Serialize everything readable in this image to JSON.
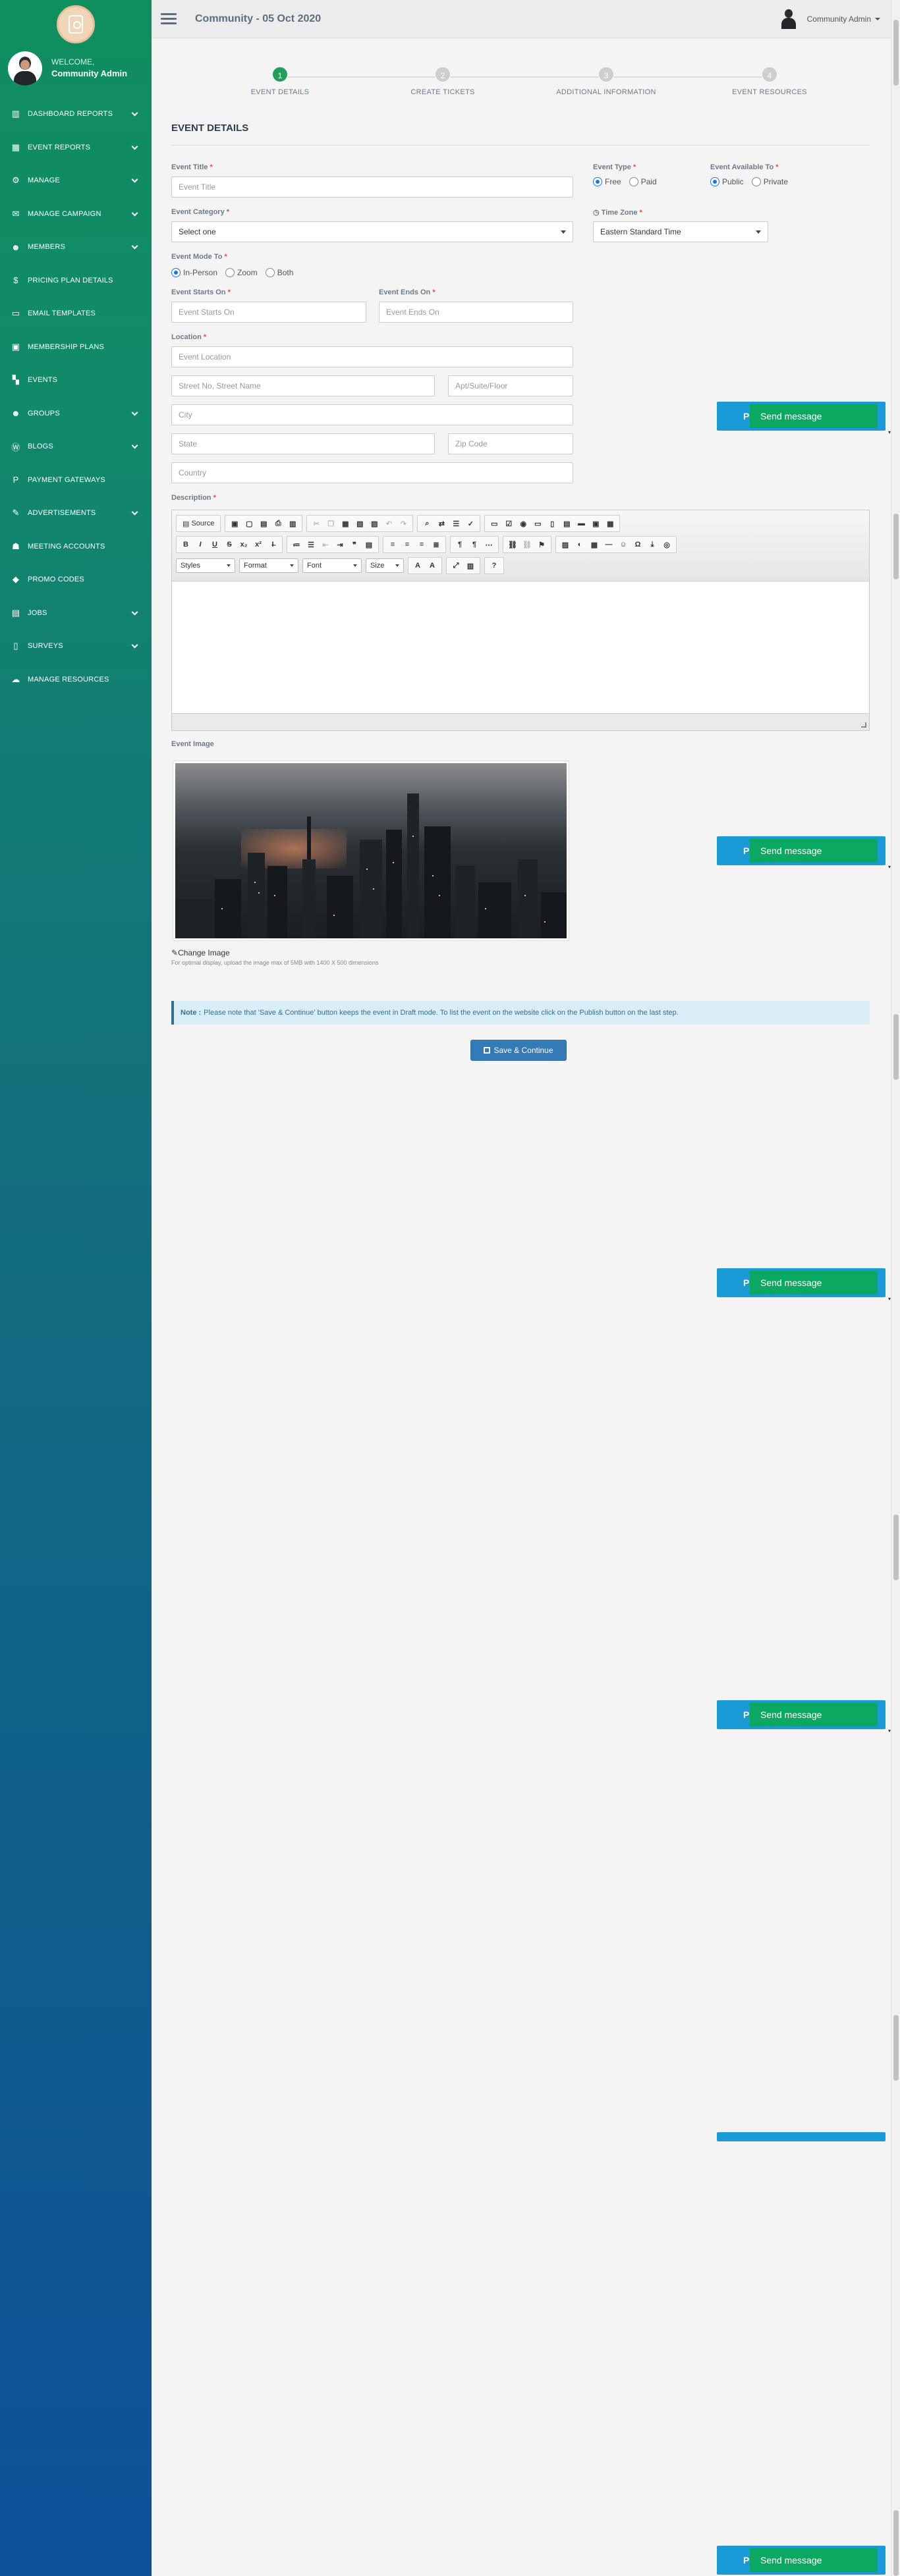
{
  "sidebar": {
    "welcome": "WELCOME,",
    "username": "Community Admin",
    "items": [
      {
        "label": "DASHBOARD REPORTS",
        "icon": "bar-chart-icon",
        "glyph": "▥",
        "chevron": true
      },
      {
        "label": "EVENT REPORTS",
        "icon": "grid-icon",
        "glyph": "▦",
        "chevron": true
      },
      {
        "label": "MANAGE",
        "icon": "gears-icon",
        "glyph": "⚙",
        "chevron": true
      },
      {
        "label": "MANAGE CAMPAIGN",
        "icon": "envelope-icon",
        "glyph": "✉",
        "chevron": true
      },
      {
        "label": "MEMBERS",
        "icon": "users-icon",
        "glyph": "☻",
        "chevron": true
      },
      {
        "label": "PRICING PLAN DETAILS",
        "icon": "dollar-icon",
        "glyph": "$",
        "chevron": false
      },
      {
        "label": "EMAIL TEMPLATES",
        "icon": "email-template-icon",
        "glyph": "▭",
        "chevron": false
      },
      {
        "label": "MEMBERSHIP PLANS",
        "icon": "id-card-icon",
        "glyph": "▣",
        "chevron": false
      },
      {
        "label": "EVENTS",
        "icon": "th-large-icon",
        "glyph": "▚",
        "chevron": false
      },
      {
        "label": "GROUPS",
        "icon": "group-icon",
        "glyph": "☻",
        "chevron": true
      },
      {
        "label": "BLOGS",
        "icon": "wordpress-icon",
        "glyph": "Ⓦ",
        "chevron": true
      },
      {
        "label": "PAYMENT GATEWAYS",
        "icon": "paypal-icon",
        "glyph": "P",
        "chevron": false
      },
      {
        "label": "ADVERTISEMENTS",
        "icon": "bullhorn-icon",
        "glyph": "✎",
        "chevron": true
      },
      {
        "label": "MEETING ACCOUNTS",
        "icon": "user-tie-icon",
        "glyph": "☗",
        "chevron": false
      },
      {
        "label": "PROMO CODES",
        "icon": "tag-icon",
        "glyph": "◆",
        "chevron": false
      },
      {
        "label": "JOBS",
        "icon": "briefcase-icon",
        "glyph": "▤",
        "chevron": true
      },
      {
        "label": "SURVEYS",
        "icon": "clipboard-icon",
        "glyph": "▯",
        "chevron": true
      },
      {
        "label": "MANAGE RESOURCES",
        "icon": "cloud-upload-icon",
        "glyph": "☁",
        "chevron": false
      }
    ]
  },
  "topbar": {
    "title": "Community - 05 Oct 2020",
    "user": "Community Admin"
  },
  "steps": [
    {
      "num": "1",
      "label": "EVENT DETAILS",
      "active": true
    },
    {
      "num": "2",
      "label": "CREATE TICKETS",
      "active": false
    },
    {
      "num": "3",
      "label": "ADDITIONAL INFORMATION",
      "active": false
    },
    {
      "num": "4",
      "label": "EVENT RESOURCES",
      "active": false
    }
  ],
  "form": {
    "section_title": "EVENT DETAILS",
    "event_title_label": "Event Title",
    "event_title_placeholder": "Event Title",
    "event_category_label": "Event Category",
    "event_category_value": "Select one",
    "event_mode_label": "Event Mode To",
    "mode_options": [
      "In-Person",
      "Zoom",
      "Both"
    ],
    "starts_label": "Event Starts On",
    "starts_placeholder": "Event Starts On",
    "ends_label": "Event Ends On",
    "ends_placeholder": "Event Ends On",
    "location_label": "Location",
    "location_placeholder": "Event Location",
    "street_placeholder": "Street No, Street Name",
    "apt_placeholder": "Apt/Suite/Floor",
    "city_placeholder": "City",
    "state_placeholder": "State",
    "zip_placeholder": "Zip Code",
    "country_placeholder": "Country",
    "event_type_label": "Event Type",
    "type_options": [
      "Free",
      "Paid"
    ],
    "available_label": "Event Available To",
    "available_options": [
      "Public",
      "Private"
    ],
    "timezone_label": "Time Zone",
    "timezone_value": "Eastern Standard Time",
    "description_label": "Description",
    "image_label": "Event Image",
    "change_image": "Change Image",
    "image_hint": "For optimal display, upload the image max of 5MB with 1400 X 500 dimensions",
    "required_mark": "*"
  },
  "editor": {
    "source_label": "Source",
    "styles": "Styles",
    "format": "Format",
    "font": "Font",
    "size": "Size",
    "help": "?"
  },
  "note": {
    "prefix": "Note :",
    "text": "Please note that 'Save & Continue' button keeps the event in Draft mode. To list the event on the website click on the Publish button on the last step."
  },
  "save_button": "Save & Continue",
  "chat": {
    "letter": "P",
    "send_label": "Send message"
  }
}
